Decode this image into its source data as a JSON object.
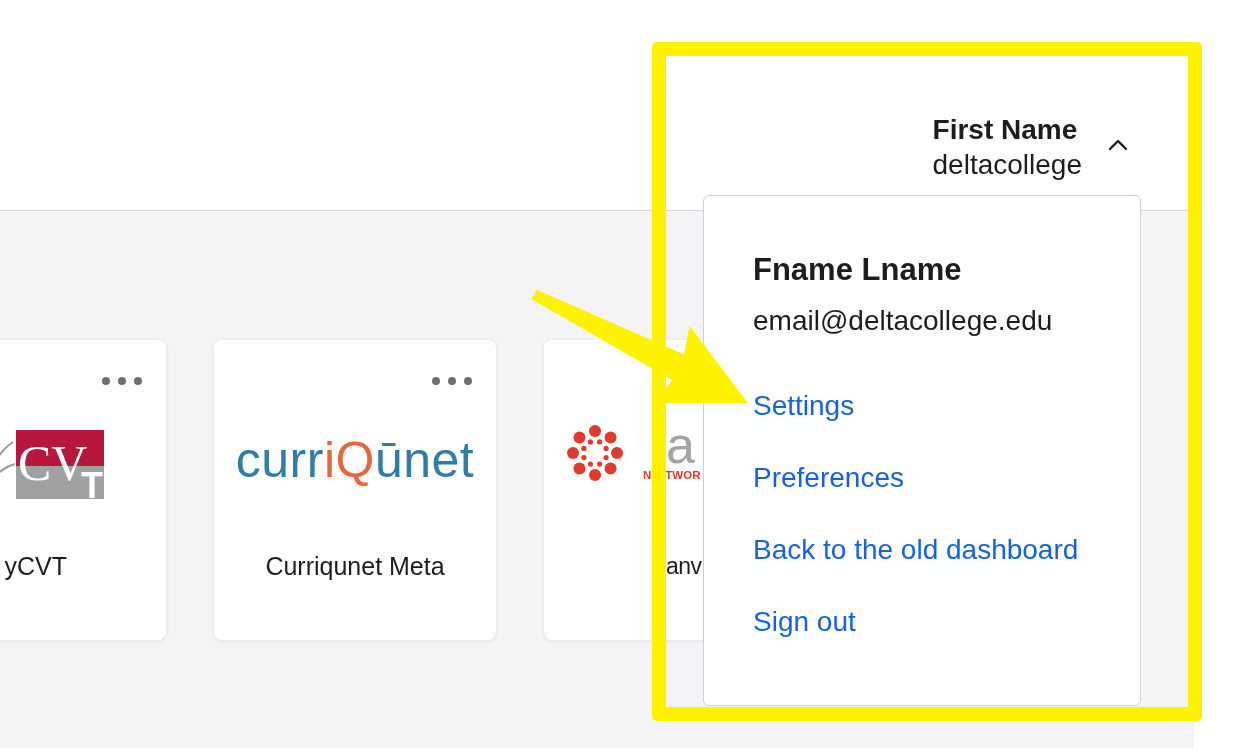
{
  "header": {
    "user": {
      "name": "First Name",
      "org": "deltacollege",
      "expanded": true
    }
  },
  "user_menu": {
    "name": "Fname Lname",
    "email": "email@deltacollege.edu",
    "links": [
      "Settings",
      "Preferences",
      "Back to the old dashboard",
      "Sign out"
    ]
  },
  "apps": [
    {
      "label": "yCVT",
      "cut_left": true,
      "cut_right": false,
      "menu": true,
      "logo": {
        "kind": "blocks",
        "parts": [
          {
            "text": "CV"
          },
          {
            "text": "T"
          }
        ]
      }
    },
    {
      "label": "Curriqunet Meta",
      "cut_left": false,
      "cut_right": false,
      "menu": true,
      "logo": {
        "kind": "wordmark",
        "parts": [
          {
            "text": "curr",
            "color": "#2f7ea6"
          },
          {
            "text": "iQ",
            "color": "#e5673c"
          },
          {
            "text": "ūnet",
            "color": "#2f7ea6"
          }
        ]
      }
    },
    {
      "label": "anv",
      "cut_left": true,
      "cut_right": true,
      "logo": {
        "kind": "ring",
        "parts": [
          {
            "text": "a",
            "color": "#a3a3a3"
          },
          {
            "text": "N",
            "color": "#e2372b"
          },
          {
            "text": "TWOR",
            "color": "#e2372b"
          }
        ]
      }
    }
  ]
}
